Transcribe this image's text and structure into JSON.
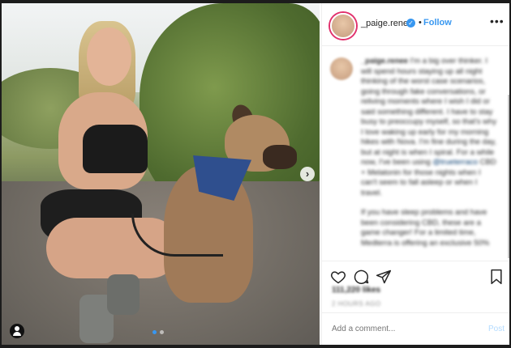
{
  "post": {
    "username": "_paige.renee",
    "verified_mark": "✓",
    "separator": "•",
    "follow_label": "Follow",
    "more_label": "•••"
  },
  "caption": {
    "username": "_paige.renee",
    "text_1": "I'm a big over thinker. I will spend hours staying up all night thinking of the worst case scenarios, going through fake conversations, or reliving moments where I wish I did or said something different. I have to stay busy to preoccupy myself, so that's why I love waking up early for my morning hikes with Nova. I'm fine during the day, but at night is when I spiral. For a while now, I've been using",
    "mention": "@trueterraco",
    "text_2": "CBD + Melatonin for those nights when I can't seem to fall asleep or when I travel.",
    "text_3": "If you have sleep problems and have been considering CBD, these are a game changer! For a limited time, Medterra is offering an exclusive 50%"
  },
  "actions": {
    "like_icon": "heart-icon",
    "comment_icon": "comment-icon",
    "share_icon": "share-icon",
    "save_icon": "bookmark-icon"
  },
  "stats": {
    "likes": "111,220 likes",
    "time": "2 HOURS AGO"
  },
  "comment": {
    "placeholder": "Add a comment...",
    "post_label": "Post"
  },
  "media": {
    "next_label": "›",
    "slide_count": 2,
    "active_slide": 1
  },
  "colors": {
    "accent": "#3897f0",
    "text": "#262626",
    "muted": "#8e8e8e"
  }
}
